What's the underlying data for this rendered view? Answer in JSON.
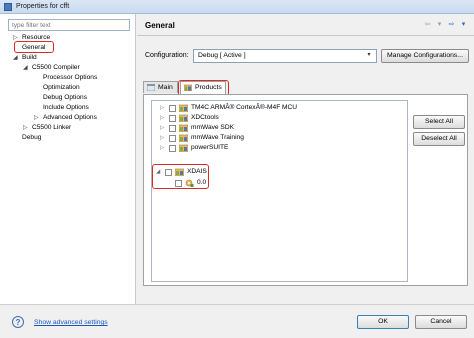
{
  "window": {
    "title": "Properties for cfft"
  },
  "filter": {
    "placeholder": "type filter text"
  },
  "nav": {
    "items": [
      {
        "label": "Resource",
        "expander": "▷"
      },
      {
        "label": "General",
        "expander": ""
      },
      {
        "label": "Build",
        "expander": "◢"
      },
      {
        "label": "C5500 Compiler",
        "expander": "◢"
      },
      {
        "label": "Processor Options",
        "expander": ""
      },
      {
        "label": "Optimization",
        "expander": ""
      },
      {
        "label": "Debug Options",
        "expander": ""
      },
      {
        "label": "Include Options",
        "expander": ""
      },
      {
        "label": "Advanced Options",
        "expander": "▷"
      },
      {
        "label": "C5500 Linker",
        "expander": "▷"
      },
      {
        "label": "Debug",
        "expander": ""
      }
    ]
  },
  "page": {
    "title": "General"
  },
  "header_nav": {
    "back": "⇦",
    "back_menu": "▾",
    "forward": "⇨",
    "forward_menu": "▾"
  },
  "configuration": {
    "label": "Configuration:",
    "value": "Debug  [ Active ]",
    "dropdown_glyph": "▾",
    "manage_label": "Manage Configurations..."
  },
  "tabs": [
    {
      "label": "Main",
      "active": false
    },
    {
      "label": "Products",
      "active": true
    }
  ],
  "products": [
    {
      "label": "TM4C ARMÂ® CortexÂ®-M4F MCU",
      "expander": "▷"
    },
    {
      "label": "XDCtools",
      "expander": "▷"
    },
    {
      "label": "mmWave SDK",
      "expander": "▷"
    },
    {
      "label": "mmWave Training",
      "expander": "▷"
    },
    {
      "label": "powerSUITE",
      "expander": "▷"
    },
    {
      "label": "XDAIS",
      "expander": "◢"
    },
    {
      "label": "0.0",
      "expander": ""
    }
  ],
  "buttons": {
    "select_all": "Select All",
    "deselect_all": "Deselect All",
    "ok": "OK",
    "cancel": "Cancel"
  },
  "footer": {
    "help_glyph": "?",
    "advanced_link": "Show advanced settings"
  },
  "colors": {
    "highlight": "#d82a2a",
    "link": "#1a56c2",
    "accent": "#3c7fb1"
  }
}
